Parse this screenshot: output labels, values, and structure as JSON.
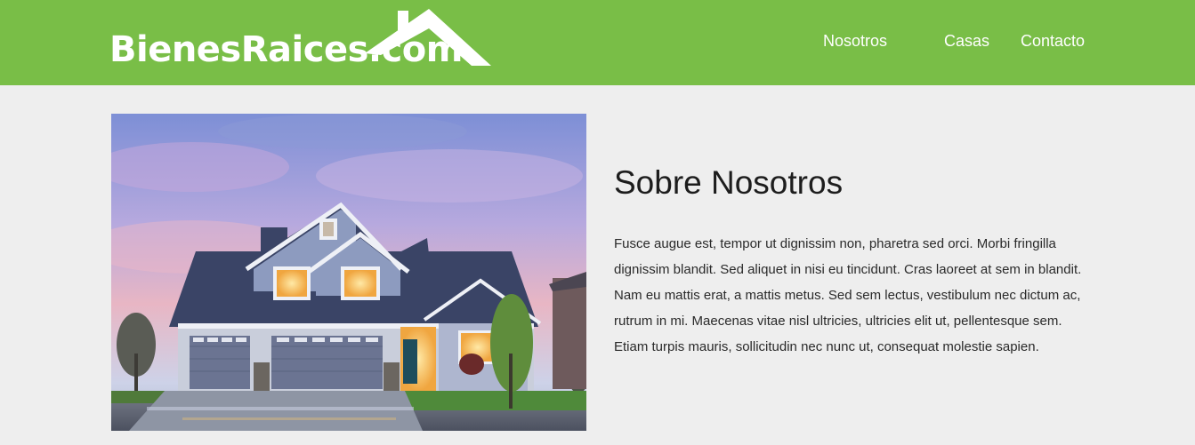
{
  "header": {
    "brand": "BienesRaices.com",
    "nav": [
      {
        "label": "Nosotros"
      },
      {
        "label": "Casas"
      },
      {
        "label": "Contacto"
      }
    ],
    "colors": {
      "bar": "#79be47",
      "text": "#ffffff"
    }
  },
  "about": {
    "title": "Sobre Nosotros",
    "text": "Fusce augue est, tempor ut dignissim non, pharetra sed orci. Morbi fringilla dignissim blandit. Sed aliquet in nisi eu tincidunt. Cras laoreet at sem in blandit. Nam eu mattis erat, a mattis metus. Sed sem lectus, vestibulum nec dictum ac, rutrum in mi. Maecenas vitae nisl ultricies, ultricies elit ut, pellentesque sem. Etiam turpis mauris, sollicitudin nec nunc ut, consequat molestie sapien.",
    "image": "house-photo"
  }
}
